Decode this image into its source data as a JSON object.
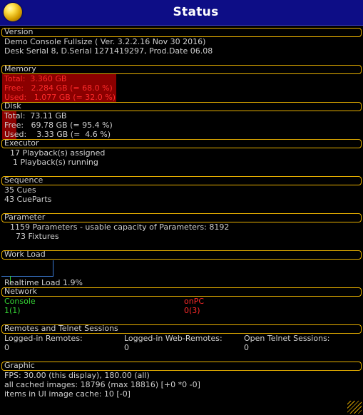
{
  "window": {
    "title": "Status"
  },
  "version": {
    "header": "Version",
    "line1": "Demo Console Fullsize ( Ver. 3.2.2.16 Nov 30 2016)",
    "line2": "Desk Serial 8, D.Serial 1271419297, Prod.Date 06.08"
  },
  "memory": {
    "header": "Memory",
    "total": "Total:  3.360 GB",
    "free": "Free:   2.284 GB (= 68.0 %)",
    "used": "Used:   1.077 GB (= 32.0 %)",
    "used_percent": 32.0,
    "free_percent": 68.0
  },
  "disk": {
    "header": "Disk",
    "total": "Total:  73.11 GB",
    "free": "Free:   69.78 GB (= 95.4 %)",
    "used": "Used:    3.33 GB (=  4.6 %)",
    "used_percent": 4.6
  },
  "executor": {
    "header": "Executor",
    "line1": "17 Playback(s) assigned",
    "line2": "1 Playback(s) running"
  },
  "sequence": {
    "header": "Sequence",
    "line1": "35 Cues",
    "line2": "43 CueParts"
  },
  "parameter": {
    "header": "Parameter",
    "line1": "1159 Parameters - usable capacity of Parameters: 8192",
    "line2": "73 Fixtures"
  },
  "workload": {
    "header": "Work Load",
    "realtime": "Realtime Load 1.9%"
  },
  "network": {
    "header": "Network",
    "console_label": "Console",
    "console_value": "1(1)",
    "onpc_label": "onPC",
    "onpc_value": "0(3)"
  },
  "remotes": {
    "header": "Remotes and Telnet Sessions",
    "loggedin_label": "Logged-in Remotes:",
    "loggedin_value": "0",
    "web_label": "Logged-in Web-Remotes:",
    "web_value": "0",
    "telnet_label": "Open Telnet Sessions:",
    "telnet_value": "0"
  },
  "graphic": {
    "header": "Graphic",
    "fps": "FPS: 30.00 (this display), 180.00 (all)",
    "cached": "all cached images: 18796 (max 18816) [+0 *0 -0]",
    "ui_cache": "items in UI image cache: 10 [-0]"
  },
  "colors": {
    "titlebar": "#0d0d86",
    "section_border": "#e8b000",
    "text": "#d0d0d0",
    "alert_red": "#ff2a2a",
    "ok_green": "#35d335",
    "bar_fill": "#8b0000"
  }
}
